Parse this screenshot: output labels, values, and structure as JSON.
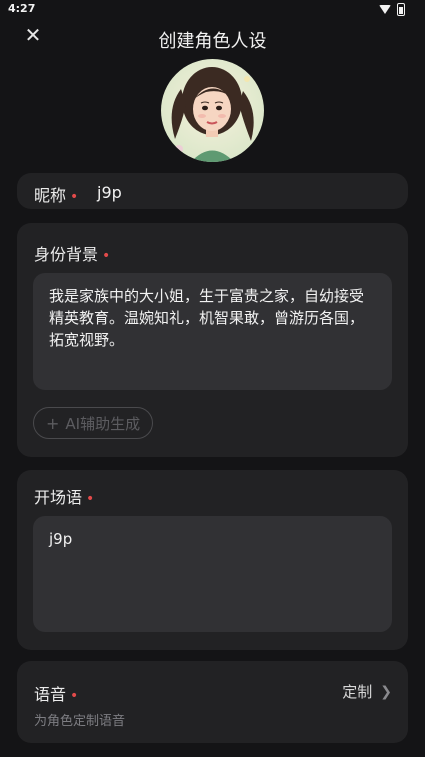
{
  "status": {
    "time": "4:27"
  },
  "header": {
    "title": "创建角色人设",
    "close_icon": "close-icon"
  },
  "avatar": {
    "icon": "avatar-portrait"
  },
  "nickname": {
    "label": "昵称",
    "required_mark": "•",
    "value": "j9p"
  },
  "identity": {
    "label": "身份背景",
    "required_mark": "•",
    "text": "我是家族中的大小姐，生于富贵之家，自幼接受精英教育。温婉知礼，机智果敢，曾游历各国，拓宽视野。",
    "ai_button": "AI辅助生成",
    "ai_icon": "plus-icon"
  },
  "opening": {
    "label": "开场语",
    "required_mark": "•",
    "text": "j9p"
  },
  "voice": {
    "label": "语音",
    "required_mark": "•",
    "value": "定制",
    "subtitle": "为角色定制语音",
    "chevron": "chevron-right-icon"
  },
  "colors": {
    "background": "#141416",
    "card": "#222224",
    "input": "#313134",
    "required": "#e24a4a"
  }
}
